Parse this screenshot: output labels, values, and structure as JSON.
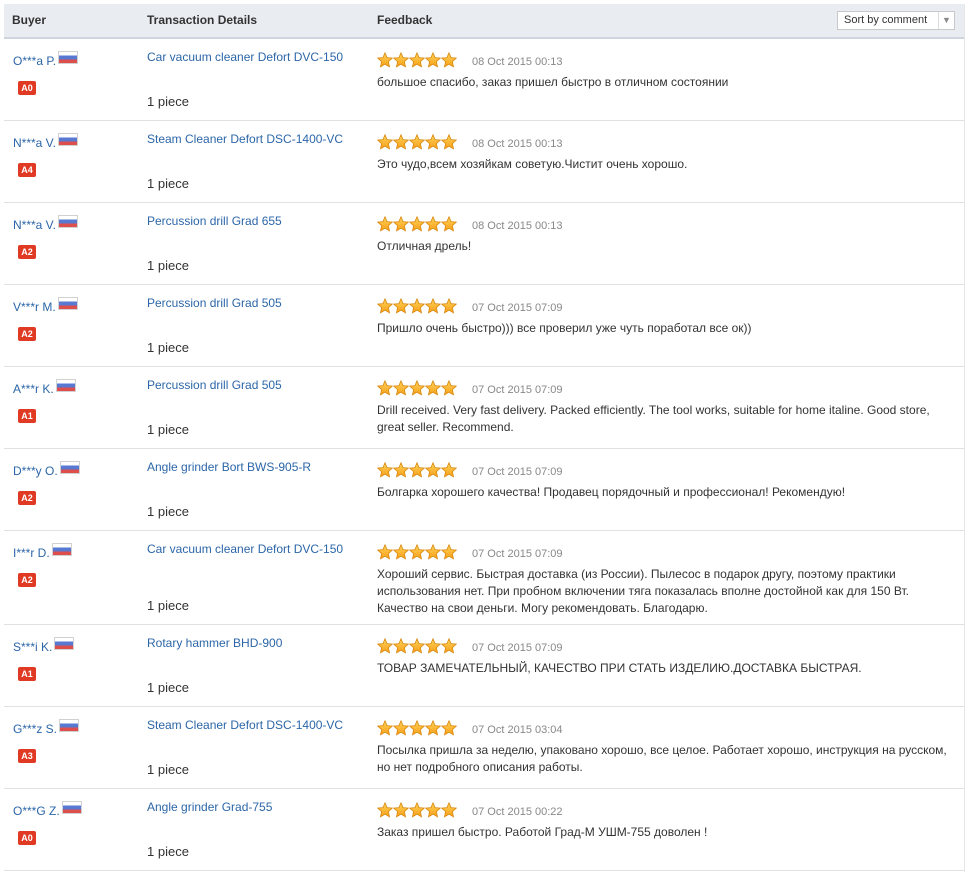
{
  "header": {
    "buyer": "Buyer",
    "transaction": "Transaction Details",
    "feedback": "Feedback",
    "sort_label": "Sort by comment"
  },
  "colors": {
    "link": "#2c66a8",
    "level_badge": "#e03a24",
    "star": "#f7a11a",
    "header_bg": "#e9ecf1"
  },
  "icons": {
    "flag": "russia-flag-icon",
    "star": "star-icon",
    "sort": "chevron-down-icon"
  },
  "reviews": [
    {
      "buyer": "O***a P.",
      "level": "A0",
      "product": "Car vacuum cleaner Defort DVC-150",
      "quantity": "1 piece",
      "rating": 5,
      "date": "08 Oct 2015 00:13",
      "comment": "большое спасибо, заказ пришел быстро в отличном состоянии"
    },
    {
      "buyer": "N***a V.",
      "level": "A4",
      "product": "Steam Cleaner Defort DSC-1400-VC",
      "quantity": "1 piece",
      "rating": 5,
      "date": "08 Oct 2015 00:13",
      "comment": "Это чудо,всем хозяйкам советую.Чистит очень хорошо."
    },
    {
      "buyer": "N***a V.",
      "level": "A2",
      "product": "Percussion drill Grad 655",
      "quantity": "1 piece",
      "rating": 5,
      "date": "08 Oct 2015 00:13",
      "comment": "Отличная дрель!"
    },
    {
      "buyer": "V***r M.",
      "level": "A2",
      "product": "Percussion drill Grad 505",
      "quantity": "1 piece",
      "rating": 5,
      "date": "07 Oct 2015 07:09",
      "comment": "Пришло очень быстро))) все проверил уже чуть поработал все ок))"
    },
    {
      "buyer": "A***r K.",
      "level": "A1",
      "product": "Percussion drill Grad 505",
      "quantity": "1 piece",
      "rating": 5,
      "date": "07 Oct 2015 07:09",
      "comment": "Drill received. Very fast delivery. Packed efficiently. The tool works, suitable for home italine. Good store, great seller. Recommend."
    },
    {
      "buyer": "D***y O.",
      "level": "A2",
      "product": "Angle grinder Bort BWS-905-R",
      "quantity": "1 piece",
      "rating": 5,
      "date": "07 Oct 2015 07:09",
      "comment": "Болгарка хорошего качества! Продавец порядочный и профессионал! Рекомендую!"
    },
    {
      "buyer": "I***r D.",
      "level": "A2",
      "product": "Car vacuum cleaner Defort DVC-150",
      "quantity": "1 piece",
      "rating": 5,
      "date": "07 Oct 2015 07:09",
      "comment": "Хороший сервис. Быстрая доставка (из России). Пылесос в подарок другу, поэтому практики использования нет. При пробном включении тяга показалась вполне достойной как для 150 Вт. Качество на свои деньги. Могу рекомендовать. Благодарю."
    },
    {
      "buyer": "S***i K.",
      "level": "A1",
      "product": "Rotary hammer BHD-900",
      "quantity": "1 piece",
      "rating": 5,
      "date": "07 Oct 2015 07:09",
      "comment": "ТОВАР ЗАМЕЧАТЕЛЬНЫЙ, КАЧЕСТВО ПРИ СТАТЬ ИЗДЕЛИЮ.ДОСТАВКА БЫСТРАЯ."
    },
    {
      "buyer": "G***z S.",
      "level": "A3",
      "product": "Steam Cleaner Defort DSC-1400-VC",
      "quantity": "1 piece",
      "rating": 5,
      "date": "07 Oct 2015 03:04",
      "comment": "Посылка пришла за неделю, упаковано хорошо, все целое. Работает хорошо, инструкция на русском, но нет подробного описания работы."
    },
    {
      "buyer": "O***G Z.",
      "level": "A0",
      "product": "Angle grinder Grad-755",
      "quantity": "1 piece",
      "rating": 5,
      "date": "07 Oct 2015 00:22",
      "comment": "Заказ пришел быстро. Работой Град-М УШМ-755 доволен !"
    }
  ]
}
